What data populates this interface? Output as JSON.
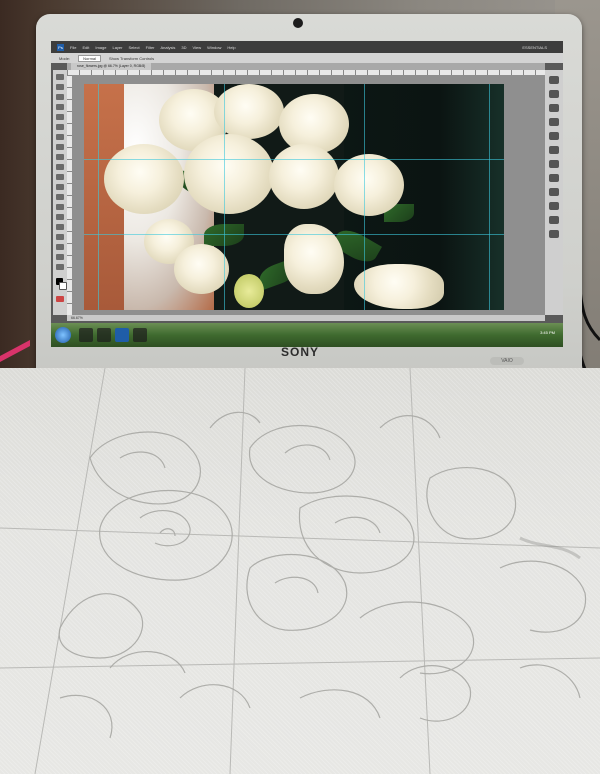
{
  "laptop": {
    "brand": "SONY",
    "badge": "VAIO"
  },
  "photoshop": {
    "app_logo": "Ps",
    "menu": [
      "File",
      "Edit",
      "Image",
      "Layer",
      "Select",
      "Filter",
      "Analysis",
      "3D",
      "View",
      "Window",
      "Help"
    ],
    "workspace": "ESSENTIALS",
    "options": [
      "Mode:",
      "Normal",
      "Show Transform Controls"
    ],
    "document_tab": "rose_flowers.jpg @ 66.7% (Layer 0, RGB/8)",
    "status_text": "66.67%",
    "clock": "3:45 PM"
  },
  "colors": {
    "taskbar": "#3f6a2f",
    "guides": "#3cc8dc",
    "paper": "#e4e4e1"
  }
}
